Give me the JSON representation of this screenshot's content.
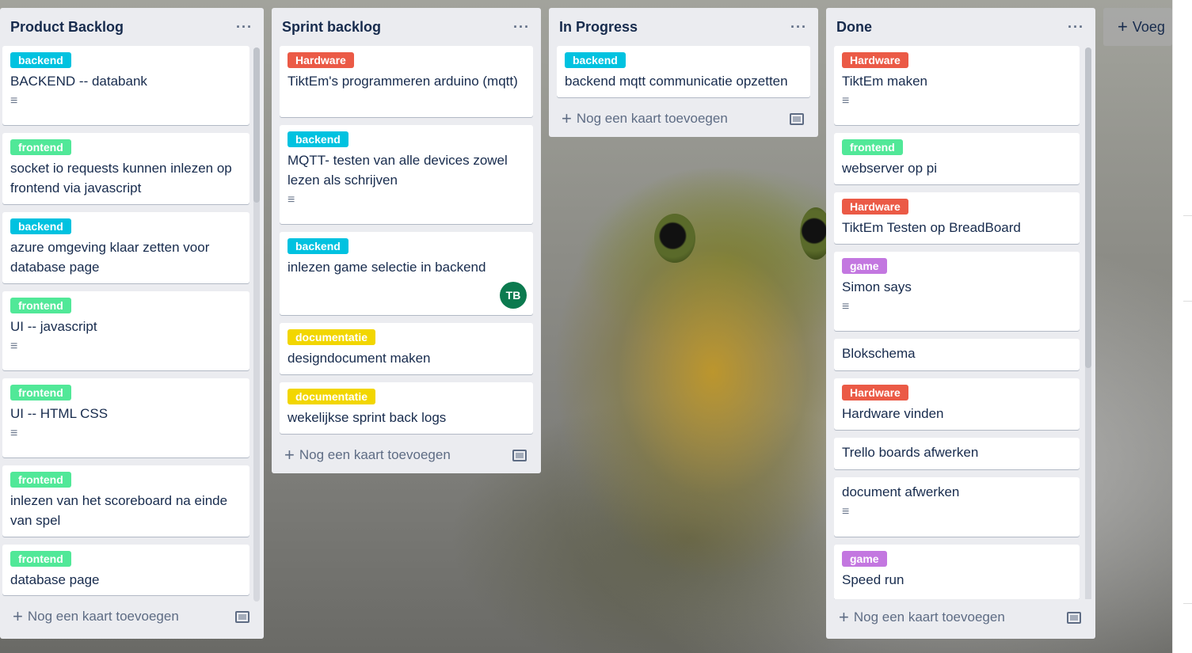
{
  "lists": [
    {
      "title": "Product Backlog",
      "cards": [
        {
          "label": "backend",
          "label_color": "#00c2e0",
          "title": "BACKEND -- databank",
          "has_desc": true
        },
        {
          "label": "frontend",
          "label_color": "#51e898",
          "title": "socket io requests kunnen inlezen op frontend via javascript",
          "has_desc": false
        },
        {
          "label": "backend",
          "label_color": "#00c2e0",
          "title": "azure omgeving klaar zetten voor database page",
          "has_desc": false
        },
        {
          "label": "frontend",
          "label_color": "#51e898",
          "title": "UI -- javascript",
          "has_desc": true
        },
        {
          "label": "frontend",
          "label_color": "#51e898",
          "title": "UI -- HTML CSS",
          "has_desc": true
        },
        {
          "label": "frontend",
          "label_color": "#51e898",
          "title": "inlezen van het scoreboard na einde van spel",
          "has_desc": false
        },
        {
          "label": "frontend",
          "label_color": "#51e898",
          "title": "database page",
          "has_desc": false
        }
      ],
      "add_card": "Nog een kaart toevoegen"
    },
    {
      "title": "Sprint backlog",
      "cards": [
        {
          "label": "Hardware",
          "label_color": "#eb5a46",
          "title": "TiktEm's programmeren arduino (mqtt)",
          "has_desc": false
        },
        {
          "label": "backend",
          "label_color": "#00c2e0",
          "title": "MQTT- testen van alle devices zowel lezen als schrijven",
          "has_desc": true
        },
        {
          "label": "backend",
          "label_color": "#00c2e0",
          "title": "inlezen game selectie in backend",
          "has_desc": false,
          "member": "TB"
        },
        {
          "label": "documentatie",
          "label_color": "#f2d600",
          "title": "designdocument maken",
          "has_desc": false
        },
        {
          "label": "documentatie",
          "label_color": "#f2d600",
          "title": "wekelijkse sprint back logs",
          "has_desc": false
        }
      ],
      "add_card": "Nog een kaart toevoegen"
    },
    {
      "title": "In Progress",
      "cards": [
        {
          "label": "backend",
          "label_color": "#00c2e0",
          "title": "backend mqtt communicatie opzetten",
          "has_desc": false
        }
      ],
      "add_card": "Nog een kaart toevoegen"
    },
    {
      "title": "Done",
      "cards": [
        {
          "label": "Hardware",
          "label_color": "#eb5a46",
          "title": "TiktEm maken",
          "has_desc": true
        },
        {
          "label": "frontend",
          "label_color": "#51e898",
          "title": "webserver op pi",
          "has_desc": false
        },
        {
          "label": "Hardware",
          "label_color": "#eb5a46",
          "title": "TiktEm Testen op BreadBoard",
          "has_desc": false
        },
        {
          "label": "game",
          "label_color": "#c377e0",
          "title": "Simon says",
          "has_desc": true
        },
        {
          "label": "",
          "label_color": "",
          "title": "Blokschema",
          "has_desc": false
        },
        {
          "label": "Hardware",
          "label_color": "#eb5a46",
          "title": "Hardware vinden",
          "has_desc": false
        },
        {
          "label": "",
          "label_color": "",
          "title": "Trello boards afwerken",
          "has_desc": false
        },
        {
          "label": "",
          "label_color": "",
          "title": "document afwerken",
          "has_desc": true
        },
        {
          "label": "game",
          "label_color": "#c377e0",
          "title": "Speed run",
          "has_desc": false
        }
      ],
      "add_card": "Nog een kaart toevoegen"
    }
  ],
  "add_list_label": "Voeg",
  "icons": {
    "menu": "more-horizontal-icon",
    "desc": "description-icon",
    "plus": "plus-icon",
    "template": "card-template-icon"
  }
}
